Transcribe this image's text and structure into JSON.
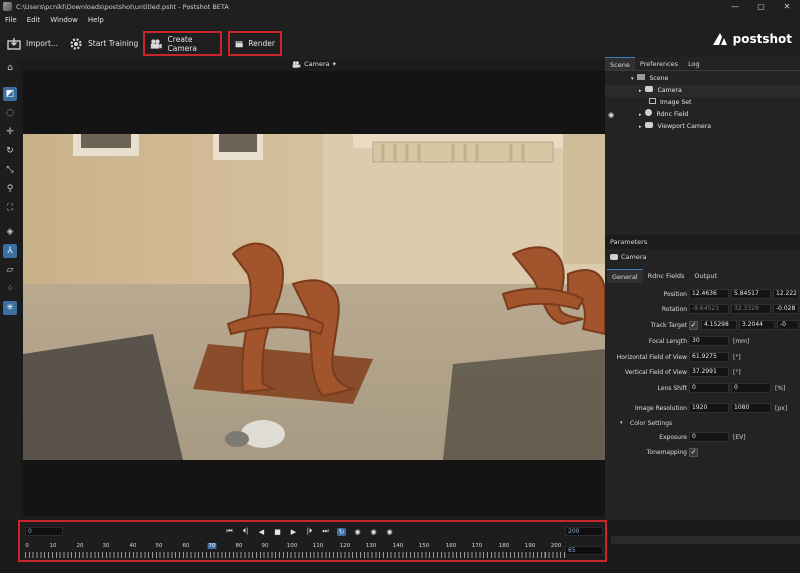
{
  "window": {
    "title": "C:\\Users\\pcnikl\\Downloads\\postshot\\untitled.psht - Postshot BETA",
    "controls": [
      "—",
      "▢",
      "✕"
    ]
  },
  "menu": [
    "File",
    "Edit",
    "Window",
    "Help"
  ],
  "toolbar": {
    "import_label": "Import...",
    "start_training_label": "Start Training",
    "create_camera_label": "Create Camera",
    "render_label": "Render",
    "logo_text": "postshot"
  },
  "viewport": {
    "camera_selector": "Camera",
    "camera_caret": "▾"
  },
  "scene_panel": {
    "tabs": [
      "Scene",
      "Preferences",
      "Log"
    ],
    "tree": {
      "root": "Scene",
      "items": [
        "Camera",
        "Image Set",
        "Rdnc Field",
        "Viewport Camera"
      ]
    }
  },
  "parameters": {
    "header": "Parameters",
    "object": "Camera",
    "tabs": [
      "General",
      "Rdnc Fields",
      "Output"
    ],
    "position": {
      "label": "Position",
      "values": [
        "12.4636",
        "5.84517",
        "12.222"
      ]
    },
    "rotation": {
      "label": "Rotation",
      "values": [
        "-9.64523",
        "32.3328",
        "-0.028"
      ]
    },
    "track_target": {
      "label": "Track Target",
      "checked": true,
      "values": [
        "4.15298",
        "3.2044",
        "-0"
      ]
    },
    "focal_length": {
      "label": "Focal Length",
      "value": "30",
      "unit": "[mm]"
    },
    "hfov": {
      "label": "Horizontal Field of View",
      "value": "61.9275",
      "unit": "[°]"
    },
    "vfov": {
      "label": "Vertical Field of View",
      "value": "37.2991",
      "unit": "[°]"
    },
    "lens_shift": {
      "label": "Lens Shift",
      "values": [
        "0",
        "0"
      ],
      "unit": "[%]"
    },
    "image_resolution": {
      "label": "Image Resolution",
      "values": [
        "1920",
        "1080"
      ],
      "unit": "[px]"
    },
    "color_settings": {
      "label": "Color Settings"
    },
    "exposure": {
      "label": "Exposure",
      "value": "0",
      "unit": "[EV]"
    },
    "tonemapping": {
      "label": "Tonemapping",
      "checked": true
    }
  },
  "timeline": {
    "start_frame": "0",
    "end_frame": "200",
    "current_frame": "65",
    "ruler_labels": [
      "0",
      "10",
      "20",
      "30",
      "40",
      "50",
      "60",
      "70",
      "80",
      "90",
      "100",
      "110",
      "120",
      "130",
      "140",
      "150",
      "160",
      "170",
      "180",
      "190",
      "200"
    ],
    "highlighted_label": "70",
    "controls": [
      "⏮",
      "⏴|",
      "◀",
      "■",
      "▶",
      "|⏵",
      "⏭",
      "↻",
      "◉",
      "◉",
      "◉"
    ]
  },
  "colors": {
    "accent": "#3a6f9f",
    "highlight_box": "#c8262b",
    "background": "#1b1b1b"
  }
}
